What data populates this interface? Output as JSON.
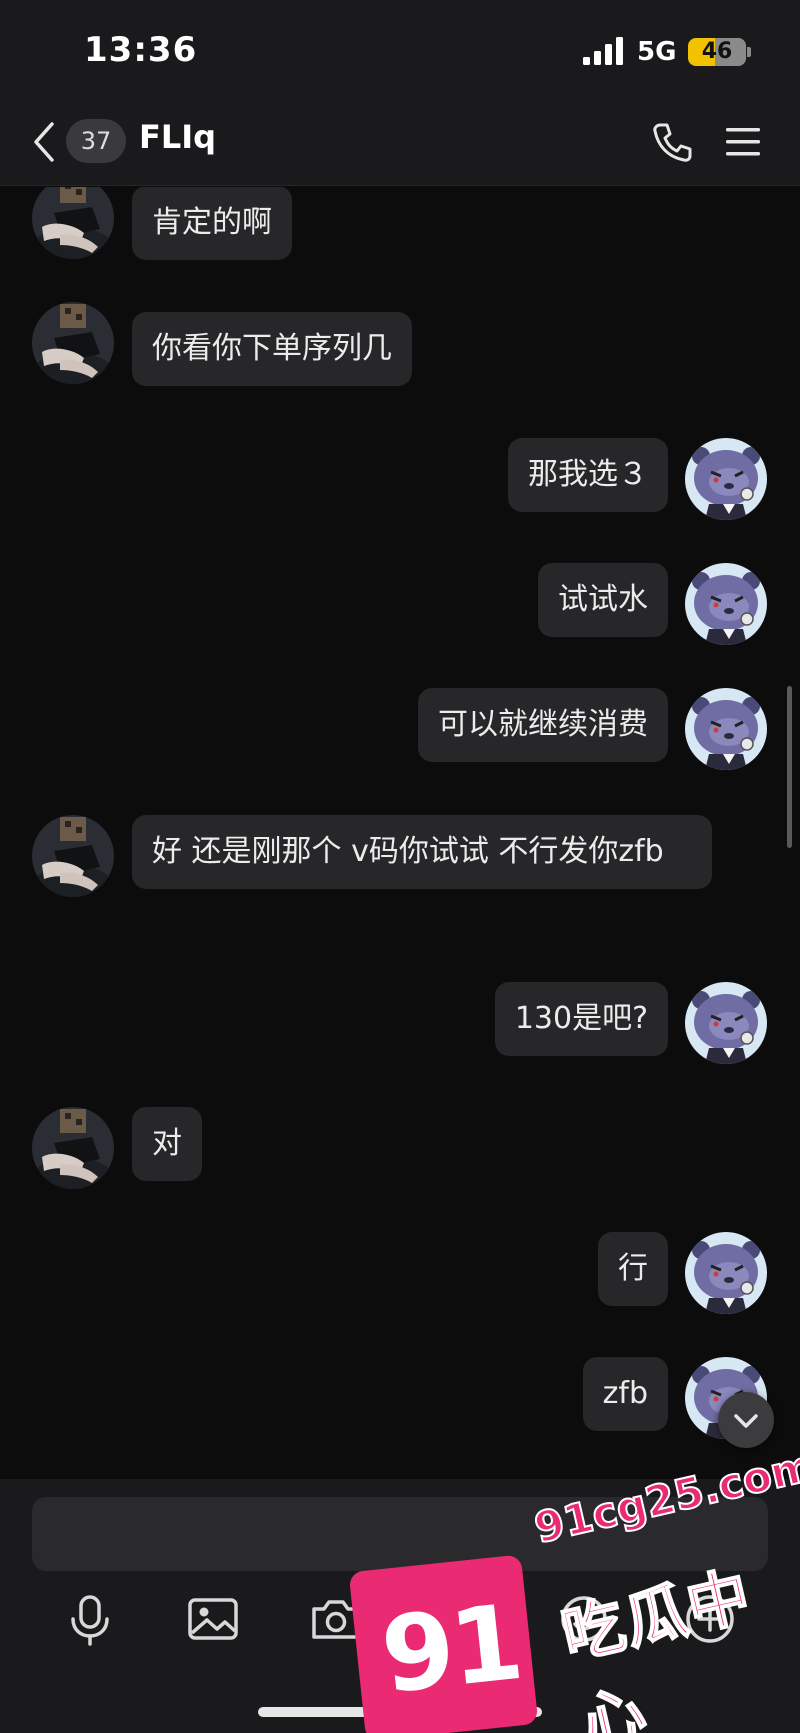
{
  "status_bar": {
    "time": "13:36",
    "network": "5G",
    "battery": "46",
    "battery_fraction": 0.46
  },
  "header": {
    "unread_count": "37",
    "contact_name": "FLIq"
  },
  "messages": [
    {
      "side": "in",
      "text": "肯定的啊"
    },
    {
      "side": "in",
      "text": "你看你下单序列几"
    },
    {
      "side": "out",
      "text": "那我选３"
    },
    {
      "side": "out",
      "text": "试试水"
    },
    {
      "side": "out",
      "text": "可以就继续消费"
    },
    {
      "side": "in",
      "text": "好 还是刚那个 v码你试试 不行发你zfb"
    },
    {
      "side": "out",
      "text": "130是吧?"
    },
    {
      "side": "in",
      "text": "对"
    },
    {
      "side": "out",
      "text": "行"
    },
    {
      "side": "out",
      "text": "zfb"
    }
  ],
  "composer": {
    "placeholder": "",
    "tools": [
      "microphone-icon",
      "image-icon",
      "camera-icon",
      "red-envelope-icon",
      "emoji-icon",
      "plus-icon"
    ]
  },
  "watermark": {
    "number": "91",
    "domain": "91cg25.com",
    "title": "吃瓜中心"
  },
  "colors": {
    "background": "#0c0c0d",
    "bar": "#1a1a1c",
    "bubble": "#27272a",
    "battery": "#f2c200",
    "watermark": "#ea2a73"
  }
}
